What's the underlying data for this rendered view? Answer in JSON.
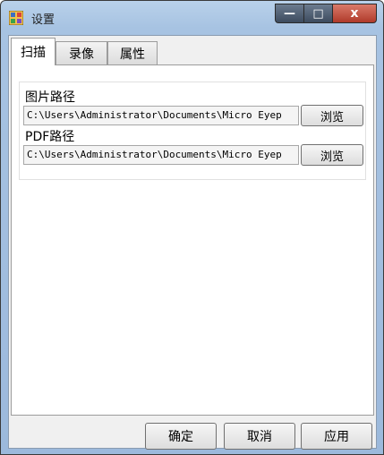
{
  "window": {
    "title": "设置",
    "buttons": {
      "minimize": "—",
      "maximize": "□",
      "close": "x"
    }
  },
  "tabs": [
    {
      "label": "扫描",
      "active": true
    },
    {
      "label": "录像",
      "active": false
    },
    {
      "label": "属性",
      "active": false
    }
  ],
  "scan": {
    "image_path": {
      "label": "图片路径",
      "value": "C:\\Users\\Administrator\\Documents\\Micro Eyep",
      "browse": "浏览"
    },
    "pdf_path": {
      "label": "PDF路径",
      "value": "C:\\Users\\Administrator\\Documents\\Micro Eyep",
      "browse": "浏览"
    }
  },
  "footer": {
    "ok": "确定",
    "cancel": "取消",
    "apply": "应用"
  }
}
